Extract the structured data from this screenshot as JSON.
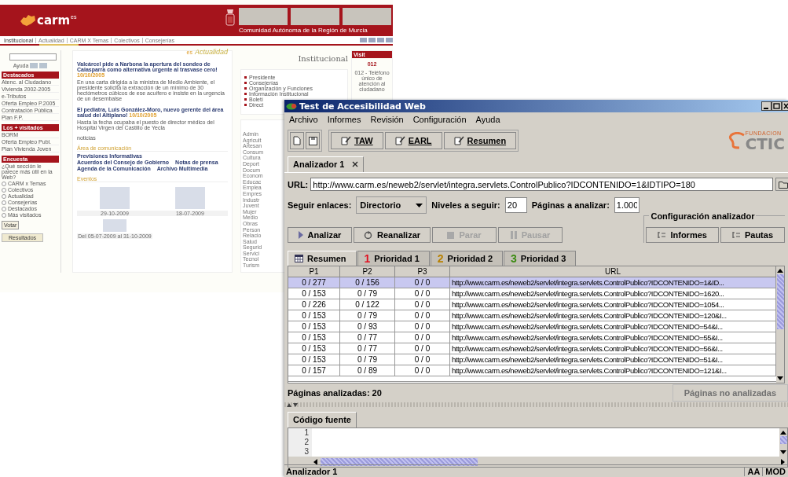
{
  "web_page": {
    "header": {
      "logo": "carm",
      "logo_suffix": "es",
      "region_title": "Comunidad Autónoma de la Región de Murcia"
    },
    "nav": [
      "Institucional",
      "Actualidad",
      "CARM X Temas",
      "Colectivos",
      "Consejerías"
    ],
    "sidebar": {
      "help": "Ayuda",
      "sections": [
        {
          "title": "Destacados",
          "items": [
            "Atenc. al Ciudadano",
            "Vivienda 2002-2005",
            "e-Tributos",
            "Oferta Empleo P.2005",
            "Contratación Pública",
            "Plan F.P."
          ]
        },
        {
          "title": "Los + visitados",
          "items": [
            "BORM",
            "Oferta Empleo Publ.",
            "Plan Vivienda Joven"
          ]
        }
      ],
      "poll": {
        "title": "Encuesta",
        "question": "¿Qué sección le parece más útil en la Web?",
        "options": [
          {
            "label": "CARM x Temas",
            "selected": false
          },
          {
            "label": "Colectivos",
            "selected": false
          },
          {
            "label": "Actualidad",
            "selected": false
          },
          {
            "label": "Consejerías",
            "selected": false
          },
          {
            "label": "Destacados",
            "selected": false
          },
          {
            "label": "Más visitados",
            "selected": false
          }
        ],
        "vote_button": "Votar",
        "results_button": "Resultados"
      }
    },
    "news": {
      "heading_prefix": "es",
      "heading": "Actualidad",
      "items": [
        {
          "title": "Valcárcel pide a Narbona la apertura del sondeo de Calasparra como alternativa urgente al trasvase cero!",
          "date": "10/10/2005",
          "summary": "En una carta dirigida a la ministra de Medio Ambiente, el presidente solicita la extracción de un mínimo de 30 hectómetros cúbicos de ese acuífero e insiste en la urgencia de un desembalse"
        },
        {
          "title": "El pediatra, Luis González-Moro, nuevo gerente del área salud del Altiplano!",
          "date": "10/10/2005",
          "summary": "Hasta la fecha ocupaba el puesto de director médico del Hospital Virgen del Castillo de Yecla"
        }
      ],
      "more": "noticias",
      "area_title": "Área de comunicación",
      "area_links": [
        "Previsiones Informativas",
        "Acuerdos del Consejo de Gobierno",
        "Notas de prensa",
        "Agenda de la Comunicación",
        "Archivo Multimedia"
      ],
      "events_title": "Eventos",
      "events": [
        {
          "caption": "29-10-2009"
        },
        {
          "caption": "18-07-2009"
        },
        {
          "caption": "Del 05-07-2009 al 31-10-2009"
        }
      ]
    },
    "institutional": {
      "heading": "Institucional",
      "items": [
        "Presidente",
        "Consejerías",
        "Organización y Funciones",
        "Información Institucional",
        "Boletí",
        "Direct"
      ],
      "topics": [
        "Admin",
        "Agricult",
        "Artesan",
        "Consum",
        "Cultura",
        "Deport",
        "Docum",
        "Econom",
        "Educac",
        "Emplea",
        "Empres",
        "Industr",
        "Juvent",
        "Mujer",
        "Medio",
        "Obras",
        "Person",
        "Relacio",
        "Salud",
        "Segurid",
        "Servici",
        "Tecnol",
        "Turism"
      ]
    },
    "visits": {
      "title": "Visit",
      "logo": "012",
      "caption": "012 - Teléfono único de atención al ciudadano"
    }
  },
  "app_window": {
    "title": "Test de Accesibilidad Web",
    "menu": [
      "Archivo",
      "Informes",
      "Revisión",
      "Configuración",
      "Ayuda"
    ],
    "toolbar_buttons": [
      "TAW",
      "EARL",
      "Resumen"
    ],
    "brand": {
      "small": "FUNDACION",
      "name": "CTIC"
    },
    "document_tabs": [
      {
        "label": "Analizador 1",
        "selected": true
      }
    ],
    "url": {
      "label": "URL:",
      "value": "http://www.carm.es/neweb2/servlet/integra.servlets.ControlPublico?IDCONTENIDO=1&IDTIPO=180"
    },
    "options": {
      "follow_label": "Seguir enlaces:",
      "follow_value": "Directorio",
      "levels_label": "Niveles a seguir:",
      "levels_value": "20",
      "pages_label": "Páginas a analizar:",
      "pages_value": "1.000"
    },
    "actions": [
      {
        "kind": "play",
        "label": "Analizar",
        "disabled": false
      },
      {
        "kind": "refresh",
        "label": "Reanalizar",
        "disabled": false
      },
      {
        "kind": "stop",
        "label": "Parar",
        "disabled": true
      },
      {
        "kind": "pause",
        "label": "Pausar",
        "disabled": true
      }
    ],
    "config_group": {
      "title": "Configuración analizador",
      "buttons": [
        "Informes",
        "Pautas"
      ]
    },
    "result_tabs": [
      {
        "kind": "summary",
        "label": "Resumen",
        "selected": true
      },
      {
        "kind": "priority",
        "marker": "1",
        "color": "#e01020",
        "label": "Prioridad 1",
        "selected": false
      },
      {
        "kind": "priority",
        "marker": "2",
        "color": "#b88000",
        "label": "Prioridad 2",
        "selected": false
      },
      {
        "kind": "priority",
        "marker": "3",
        "color": "#3a8a10",
        "label": "Prioridad 3",
        "selected": false
      }
    ],
    "table": {
      "columns": [
        "P1",
        "P2",
        "P3",
        "URL"
      ],
      "rows": [
        {
          "cells": [
            "0 / 277",
            "0 / 156",
            "0 / 0",
            "http://www.carm.es/neweb2/servlet/integra.servlets.ControlPublico?IDCONTENIDO=1&ID..."
          ],
          "selected": true
        },
        {
          "cells": [
            "0 / 153",
            "0 / 79",
            "0 / 0",
            "http://www.carm.es/neweb2/servlet/integra.servlets.ControlPublico?IDCONTENIDO=1620..."
          ],
          "selected": false
        },
        {
          "cells": [
            "0 / 226",
            "0 / 122",
            "0 / 0",
            "http://www.carm.es/neweb2/servlet/integra.servlets.ControlPublico?IDCONTENIDO=1054..."
          ],
          "selected": false
        },
        {
          "cells": [
            "0 / 153",
            "0 / 79",
            "0 / 0",
            "http://www.carm.es/neweb2/servlet/integra.servlets.ControlPublico?IDCONTENIDO=120&I..."
          ],
          "selected": false
        },
        {
          "cells": [
            "0 / 153",
            "0 / 93",
            "0 / 0",
            "http://www.carm.es/neweb2/servlet/integra.servlets.ControlPublico?IDCONTENIDO=54&I..."
          ],
          "selected": false
        },
        {
          "cells": [
            "0 / 153",
            "0 / 77",
            "0 / 0",
            "http://www.carm.es/neweb2/servlet/integra.servlets.ControlPublico?IDCONTENIDO=55&I..."
          ],
          "selected": false
        },
        {
          "cells": [
            "0 / 153",
            "0 / 77",
            "0 / 0",
            "http://www.carm.es/neweb2/servlet/integra.servlets.ControlPublico?IDCONTENIDO=56&I..."
          ],
          "selected": false
        },
        {
          "cells": [
            "0 / 153",
            "0 / 79",
            "0 / 0",
            "http://www.carm.es/neweb2/servlet/integra.servlets.ControlPublico?IDCONTENIDO=51&I..."
          ],
          "selected": false
        },
        {
          "cells": [
            "0 / 157",
            "0 / 89",
            "0 / 0",
            "http://www.carm.es/neweb2/servlet/integra.servlets.ControlPublico?IDCONTENIDO=121&I..."
          ],
          "selected": false
        }
      ]
    },
    "summary": "Páginas analizadas: 20",
    "unanalyzed_button": {
      "label": "Páginas no analizadas",
      "disabled": true
    },
    "source_tabs": [
      {
        "label": "Código fuente",
        "selected": true
      }
    ],
    "line_numbers": [
      "1",
      "2",
      "3"
    ],
    "status_bar": {
      "text": "Analizador 1",
      "indicators": [
        "AA",
        "MOD"
      ]
    }
  }
}
